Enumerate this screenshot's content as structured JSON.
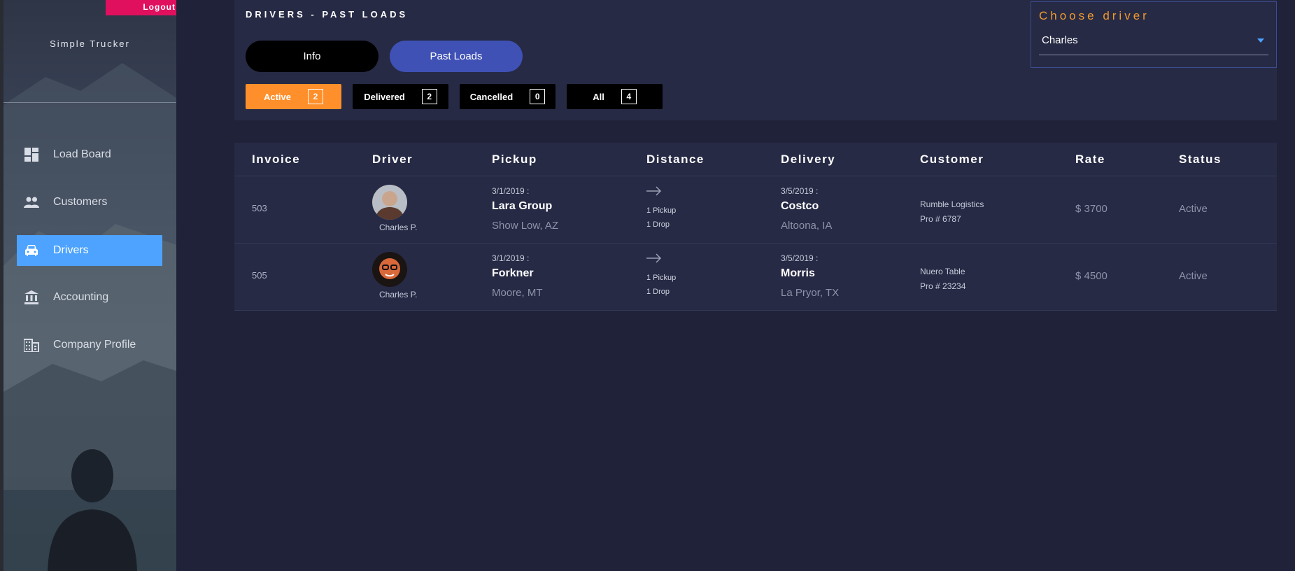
{
  "sidebar": {
    "logout_label": "Logout",
    "brand": "Simple Trucker",
    "items": [
      {
        "label": "Load Board",
        "icon": "dashboard-icon",
        "active": false
      },
      {
        "label": "Customers",
        "icon": "people-icon",
        "active": false
      },
      {
        "label": "Drivers",
        "icon": "car-icon",
        "active": true
      },
      {
        "label": "Accounting",
        "icon": "bank-icon",
        "active": false
      },
      {
        "label": "Company Profile",
        "icon": "building-icon",
        "active": false
      }
    ]
  },
  "header": {
    "title": "DRIVERS - PAST LOADS",
    "tabs": [
      {
        "label": "Info"
      },
      {
        "label": "Past Loads"
      }
    ],
    "filters": [
      {
        "label": "Active",
        "count": "2"
      },
      {
        "label": "Delivered",
        "count": "2"
      },
      {
        "label": "Cancelled",
        "count": "0"
      },
      {
        "label": "All",
        "count": "4"
      }
    ],
    "choose_driver": {
      "label": "Choose driver",
      "value": "Charles"
    }
  },
  "table": {
    "columns": [
      "Invoice",
      "Driver",
      "Pickup",
      "Distance",
      "Delivery",
      "Customer",
      "Rate",
      "Status"
    ],
    "rows": [
      {
        "invoice": "503",
        "driver": "Charles P.",
        "pickup_date": "3/1/2019 :",
        "pickup_name": "Lara Group",
        "pickup_city": "Show Low, AZ",
        "pickups": "1 Pickup",
        "drops": "1 Drop",
        "delivery_date": "3/5/2019 :",
        "delivery_name": "Costco",
        "delivery_city": "Altoona, IA",
        "customer": "Rumble Logistics",
        "pro": "Pro # 6787",
        "rate": "$ 3700",
        "status": "Active"
      },
      {
        "invoice": "505",
        "driver": "Charles P.",
        "pickup_date": "3/1/2019 :",
        "pickup_name": "Forkner",
        "pickup_city": "Moore, MT",
        "pickups": "1 Pickup",
        "drops": "1 Drop",
        "delivery_date": "3/5/2019 :",
        "delivery_name": "Morris",
        "delivery_city": "La Pryor, TX",
        "customer": "Nuero Table",
        "pro": "Pro # 23234",
        "rate": "$ 4500",
        "status": "Active"
      }
    ]
  },
  "colors": {
    "background": "#1f2238",
    "panel": "#262a45",
    "accent_orange": "#ff8f2a",
    "accent_blue": "#4da3ff",
    "logout_pink": "#e0105f",
    "tab_indigo": "#3f51b5"
  }
}
